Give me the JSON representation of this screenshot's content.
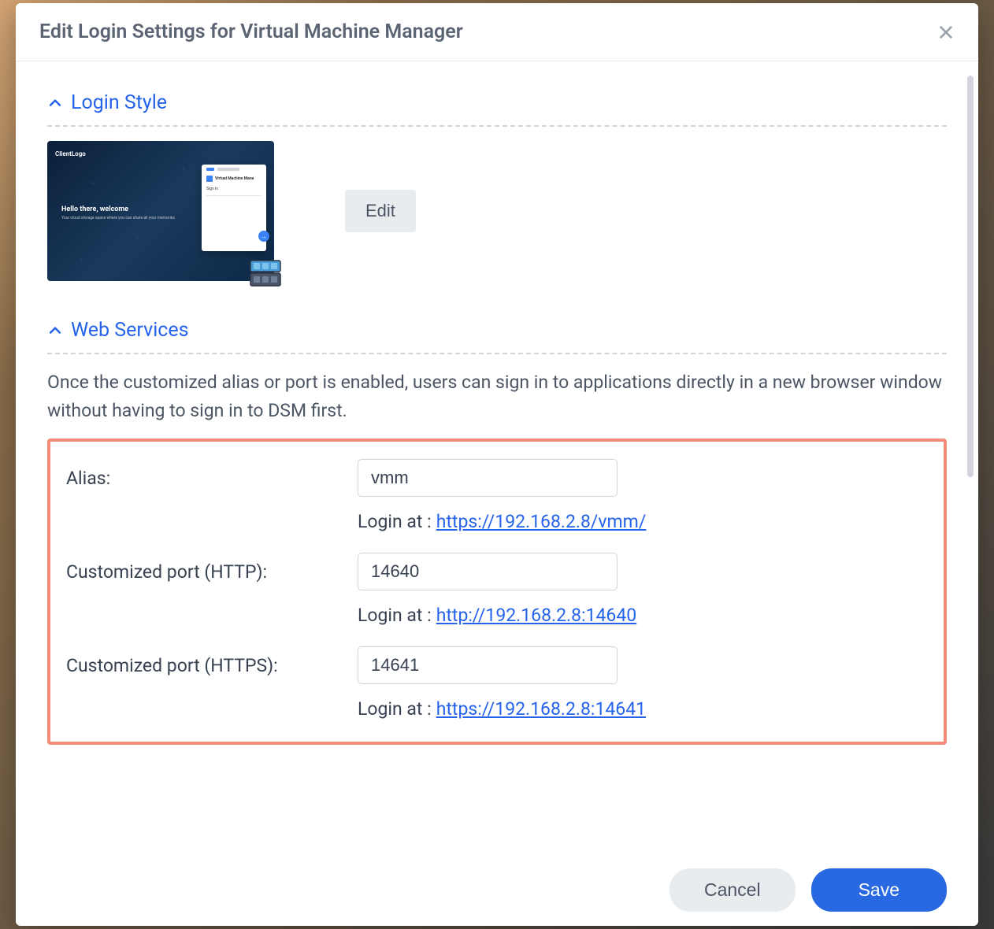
{
  "dialog": {
    "title": "Edit Login Settings for Virtual Machine Manager"
  },
  "sections": {
    "login_style": {
      "title": "Login Style",
      "edit_label": "Edit",
      "preview": {
        "logo": "ClientLogo",
        "welcome_title": "Hello there, welcome",
        "welcome_sub": "Your cloud storage space where you can share all your memories",
        "app_name": "Virtual Machine Mana",
        "signin": "Sign in"
      }
    },
    "web_services": {
      "title": "Web Services",
      "description": "Once the customized alias or port is enabled, users can sign in to applications directly in a new browser window without having to sign in to DSM first.",
      "alias_label": "Alias:",
      "alias_value": "vmm",
      "alias_login_prefix": "Login at : ",
      "alias_login_url": "https://192.168.2.8/vmm/",
      "http_label": "Customized port (HTTP):",
      "http_value": "14640",
      "http_login_prefix": "Login at : ",
      "http_login_url": "http://192.168.2.8:14640",
      "https_label": "Customized port (HTTPS):",
      "https_value": "14641",
      "https_login_prefix": "Login at : ",
      "https_login_url": "https://192.168.2.8:14641"
    }
  },
  "footer": {
    "cancel_label": "Cancel",
    "save_label": "Save"
  }
}
